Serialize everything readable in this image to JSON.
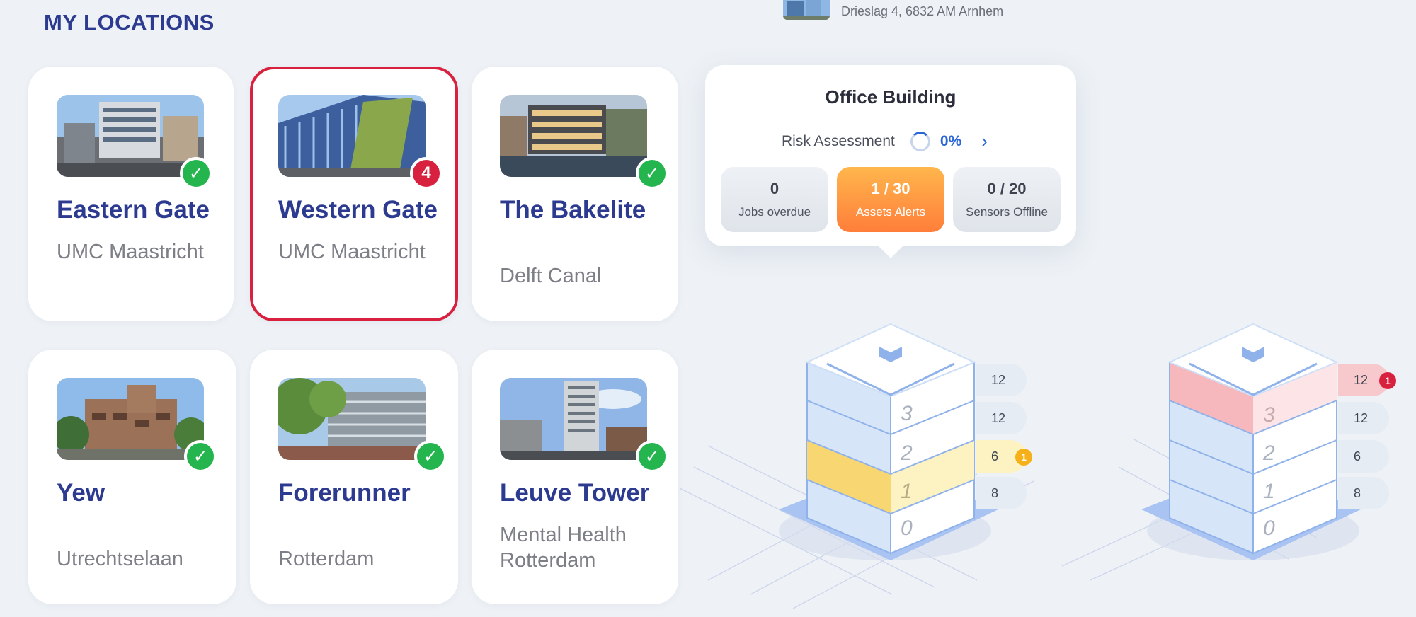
{
  "section_title": "MY LOCATIONS",
  "building_header": {
    "address": "Drieslag 4, 6832 AM Arnhem"
  },
  "locations": [
    {
      "name": "Eastern Gate",
      "sub": "UMC Maastricht",
      "status": "ok"
    },
    {
      "name": "Western Gate",
      "sub": "UMC Maastricht",
      "status": "alert",
      "alert_count": "4"
    },
    {
      "name": "The Bakelite",
      "sub": "Delft Canal",
      "status": "ok"
    },
    {
      "name": "Yew",
      "sub": "Utrechtselaan",
      "status": "ok"
    },
    {
      "name": "Forerunner",
      "sub": "Rotterdam",
      "status": "ok"
    },
    {
      "name": "Leuve Tower",
      "sub": "Mental Health Rotterdam",
      "status": "ok"
    }
  ],
  "popup": {
    "title": "Office Building",
    "risk_label": "Risk Assessment",
    "risk_value": "0%",
    "stats": [
      {
        "value": "0",
        "label": "Jobs overdue"
      },
      {
        "value": "1 / 30",
        "label": "Assets Alerts"
      },
      {
        "value": "0 / 20",
        "label": "Sensors Offline"
      }
    ]
  },
  "buildings": [
    {
      "floor_numbers": [
        "3",
        "2",
        "1",
        "0"
      ],
      "floor_counts": [
        "12",
        "12",
        "6",
        "8"
      ],
      "alert_badge": "1",
      "highlight": "yellow"
    },
    {
      "floor_numbers": [
        "3",
        "2",
        "1",
        "0"
      ],
      "floor_counts": [
        "12",
        "12",
        "6",
        "8"
      ],
      "alert_badge": "1",
      "highlight": "red"
    }
  ],
  "colors": {
    "accent": "#2c3a8f",
    "alert": "#d8213f",
    "ok": "#25b54f",
    "orange": "#ff7e3a",
    "warning": "#f6b01a"
  }
}
